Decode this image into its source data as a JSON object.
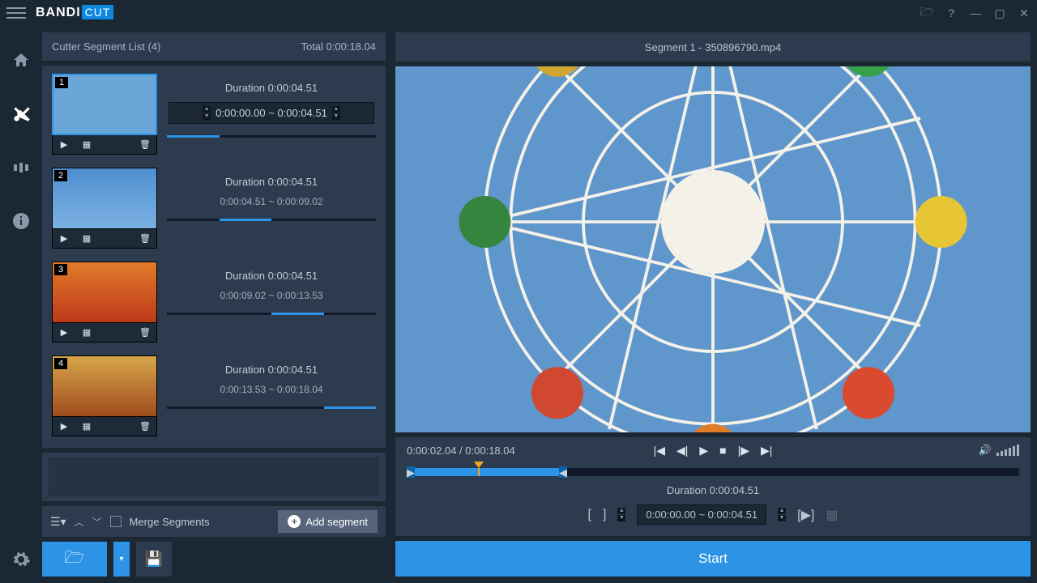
{
  "brand": {
    "a": "BANDI",
    "b": "CUT"
  },
  "segment_list": {
    "title": "Cutter Segment List (4)",
    "total_label": "Total 0:00:18.04",
    "merge_label": "Merge Segments",
    "add_label": "Add segment",
    "segments": [
      {
        "num": "1",
        "duration": "Duration 0:00:04.51",
        "range": "0:00:00.00 ~ 0:00:04.51",
        "fill_left": "0%",
        "fill_width": "25%",
        "selected": true
      },
      {
        "num": "2",
        "duration": "Duration 0:00:04.51",
        "range": "0:00:04.51 ~ 0:00:09.02",
        "fill_left": "25%",
        "fill_width": "25%",
        "selected": false
      },
      {
        "num": "3",
        "duration": "Duration 0:00:04.51",
        "range": "0:00:09.02 ~ 0:00:13.53",
        "fill_left": "50%",
        "fill_width": "25%",
        "selected": false
      },
      {
        "num": "4",
        "duration": "Duration 0:00:04.51",
        "range": "0:00:13.53 ~ 0:00:18.04",
        "fill_left": "75%",
        "fill_width": "25%",
        "selected": false
      }
    ]
  },
  "preview": {
    "title": "Segment 1 - 350896790.mp4",
    "time": "0:00:02.04 / 0:00:18.04",
    "duration_label": "Duration 0:00:04.51",
    "range": "0:00:00.00 ~ 0:00:04.51"
  },
  "start_label": "Start"
}
